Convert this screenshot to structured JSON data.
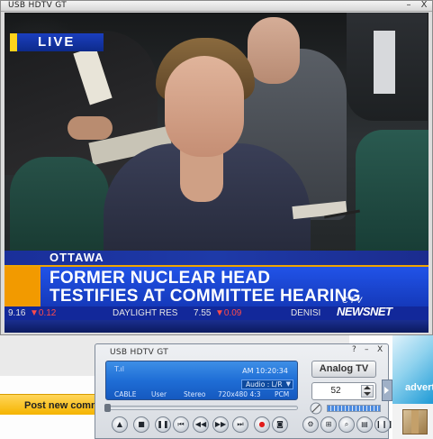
{
  "background_page": {
    "comment_label": "Post new commer",
    "ad_text": "adverti"
  },
  "main_window": {
    "title": "USB HDTV GT",
    "minimize_label": "–",
    "close_label": "X"
  },
  "broadcast": {
    "live_label": "LIVE",
    "location": "OTTAWA",
    "headline_line1": "FORMER NUCLEAR HEAD",
    "headline_line2": "TESTIFIES AT COMMITTEE HEARING",
    "ticker": {
      "item1_value": "9.16",
      "item1_change": "▼0.12",
      "item2_name": "DAYLIGHT RES",
      "item3_value": "7.55",
      "item3_change": "▼0.09",
      "item4_name": "DENISI"
    },
    "logo_top": "CTV",
    "logo_bottom": "NEWSNET"
  },
  "control_panel": {
    "title": "USB HDTV GT",
    "help_label": "?",
    "minimize_label": "–",
    "close_label": "X",
    "lcd": {
      "signal": "T.ıl",
      "time": "AM 10:20:34",
      "audio": "Audio : L/R",
      "source": "CABLE",
      "mode": "User",
      "sound": "Stereo",
      "resolution": "720x480 4:3",
      "format": "PCM"
    },
    "analog_tv_button": "Analog TV",
    "channel_value": "52",
    "buttons": [
      {
        "name": "eject-button",
        "glyph": "▲"
      },
      {
        "name": "stop-button",
        "glyph": "■"
      },
      {
        "name": "pause-button",
        "glyph": "❚❚"
      },
      {
        "name": "skip-back-button",
        "glyph": "⏮"
      },
      {
        "name": "rewind-button",
        "glyph": "◀◀"
      },
      {
        "name": "fast-forward-button",
        "glyph": "▶▶"
      },
      {
        "name": "skip-forward-button",
        "glyph": "⏭"
      },
      {
        "name": "record-button",
        "glyph": "●"
      },
      {
        "name": "snapshot-button",
        "glyph": "◙"
      },
      {
        "name": "settings-button",
        "glyph": "⚙"
      },
      {
        "name": "picture-in-picture-button",
        "glyph": "⊞"
      },
      {
        "name": "zoom-button",
        "glyph": "⌕"
      },
      {
        "name": "list-button",
        "glyph": "▤"
      },
      {
        "name": "equalizer-button",
        "glyph": "❙❙❙"
      }
    ]
  }
}
